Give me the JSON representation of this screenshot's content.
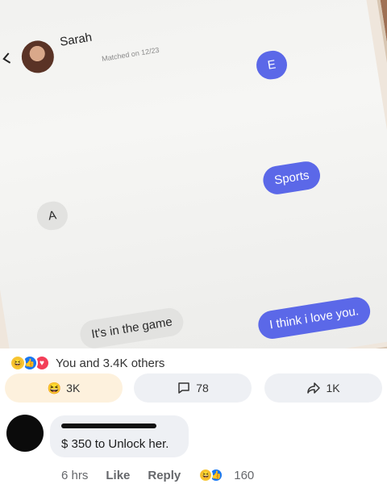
{
  "chat": {
    "contact_name": "Sarah",
    "matched_text": "Matched on 12/23",
    "messages": [
      {
        "side": "out",
        "text": "E"
      },
      {
        "side": "in",
        "text": "A"
      },
      {
        "side": "out",
        "text": "Sports"
      },
      {
        "side": "in",
        "text": "It's in the game"
      },
      {
        "side": "out",
        "text": "I think i love you."
      }
    ]
  },
  "post": {
    "reactions_summary": "You and 3.4K others",
    "haha_count": "3K",
    "comment_count": "78",
    "share_count": "1K",
    "comment": {
      "text": "$ 350 to Unlock her.",
      "time": "6 hrs",
      "like_label": "Like",
      "reply_label": "Reply",
      "reaction_count": "160"
    }
  },
  "colors": {
    "outgoing_bubble": "#5b68e8",
    "incoming_bubble": "#e2e2e0",
    "button_bg": "#eef0f4",
    "haha_button_bg": "#fdf1dd"
  }
}
